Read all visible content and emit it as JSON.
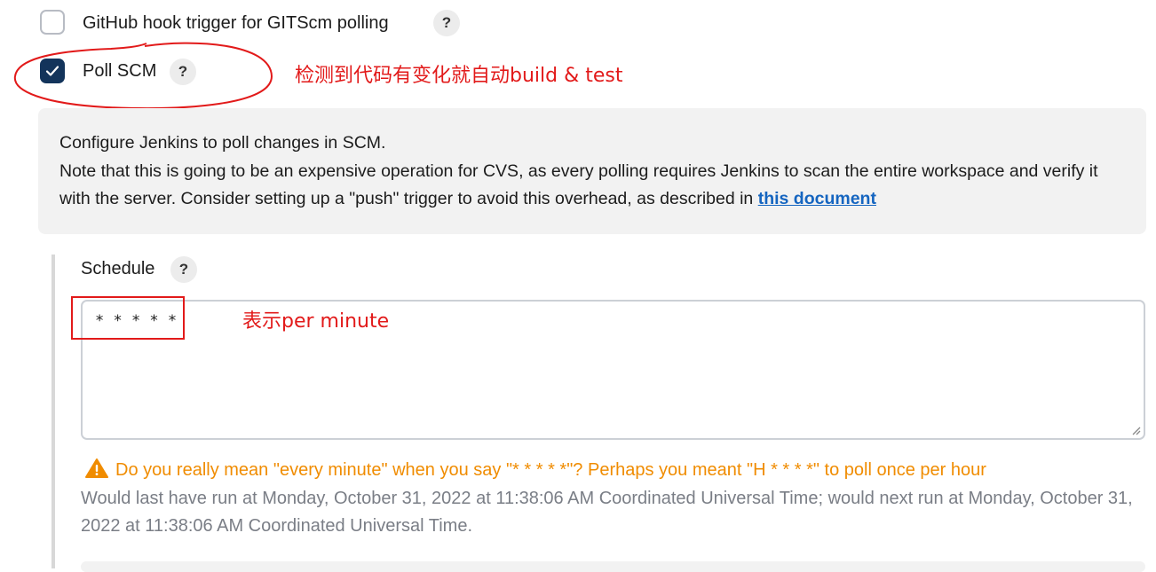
{
  "github_hook": {
    "label": "GitHub hook trigger for GITScm polling",
    "checked": false,
    "help_label": "?"
  },
  "poll_scm": {
    "label": "Poll SCM",
    "checked": true,
    "help_label": "?",
    "annotation": "检测到代码有变化就自动build & test"
  },
  "help_text": {
    "line1": "Configure Jenkins to poll changes in SCM.",
    "line2": "Note that this is going to be an expensive operation for CVS, as every polling requires Jenkins to scan the entire workspace and verify it with the server. Consider setting up a \"push\" trigger to avoid this overhead, as described in",
    "link": "this document"
  },
  "schedule": {
    "label": "Schedule",
    "help_label": "?",
    "value": "* * * * *",
    "annotation": "表示per minute"
  },
  "warning": {
    "icon": "warning-icon",
    "text": "Do you really mean \"every minute\" when you say \"* * * * *\"? Perhaps you meant \"H * * * *\" to poll once per hour"
  },
  "run_info": "Would last have run at Monday, October 31, 2022 at 11:38:06 AM Coordinated Universal Time; would next run at Monday, October 31, 2022 at 11:38:06 AM Coordinated Universal Time.",
  "colors": {
    "annotation_red": "#e21a1a",
    "checkbox_checked": "#13345b",
    "warning_orange": "#f08c00",
    "link_blue": "#1565c0"
  }
}
